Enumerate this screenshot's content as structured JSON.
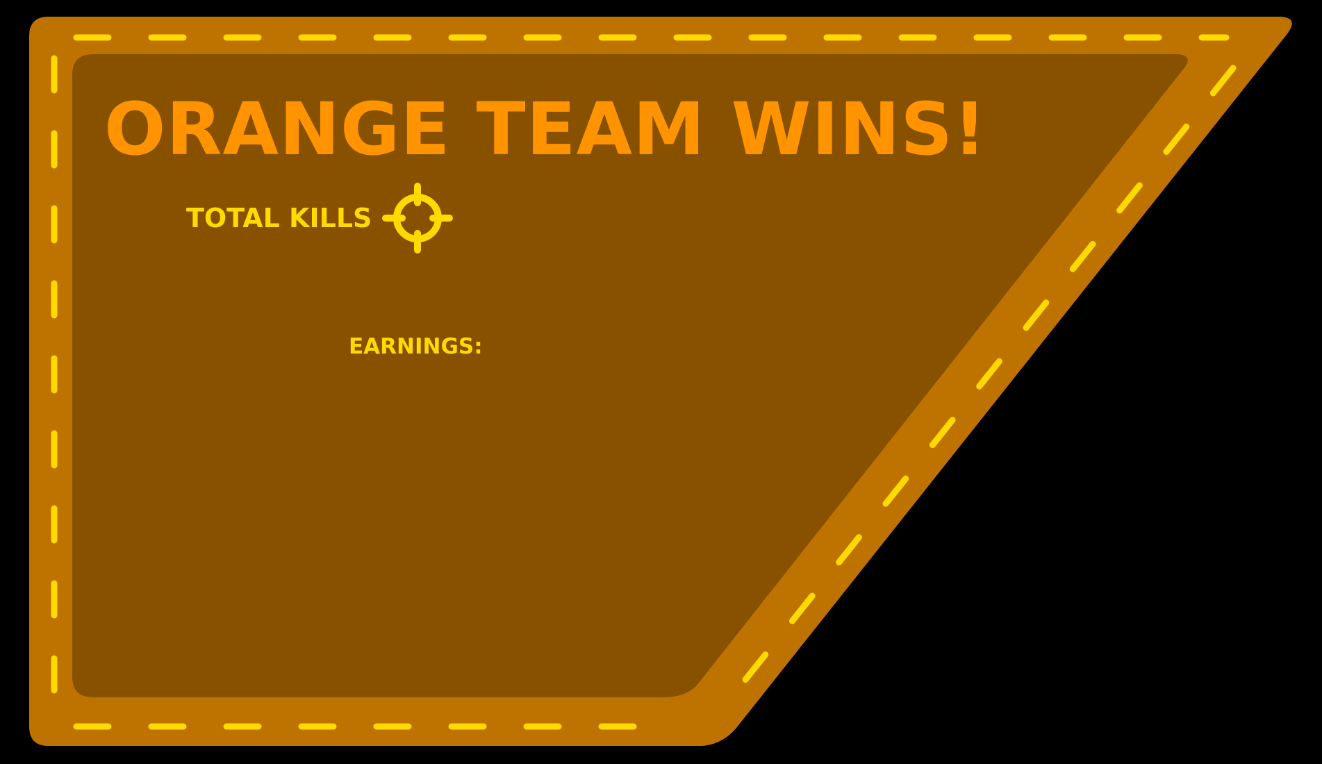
{
  "screen": {
    "title": "ORANGE TEAM WINS!",
    "total_kills_label": "TOTAL KILLS",
    "total_kills_icon": "crosshair-icon",
    "earnings_label": "EARNINGS:"
  },
  "colors": {
    "background": "#000000",
    "panel_outer": "#BE7300",
    "panel_inner": "#875100",
    "stitch": "#FFDA00",
    "title": "#FF9400",
    "label": "#FFDA00"
  }
}
